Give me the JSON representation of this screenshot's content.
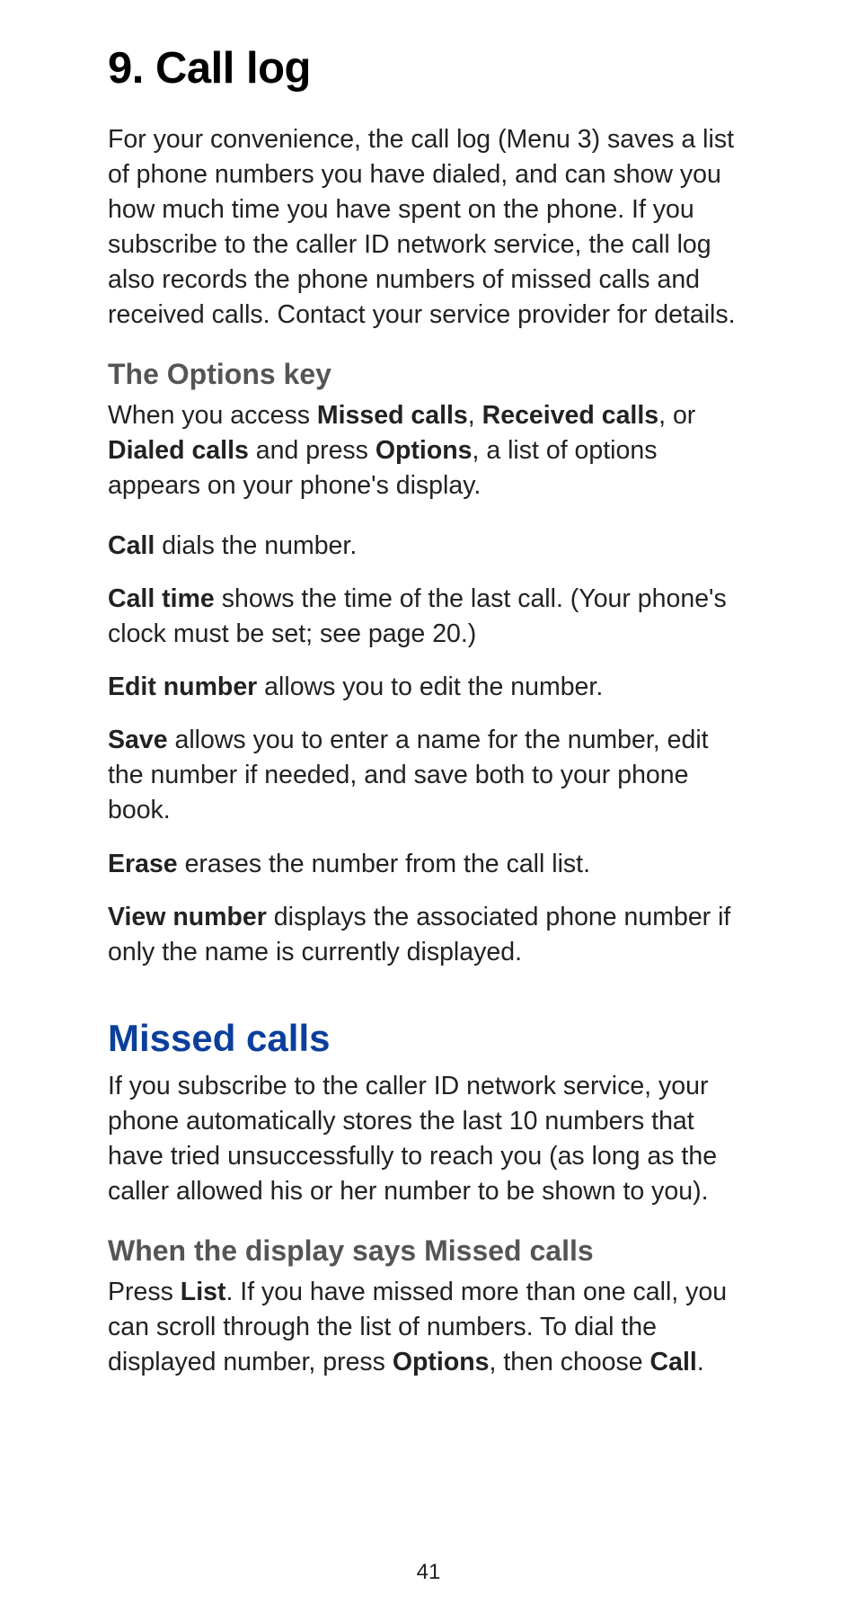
{
  "title": "9. Call log",
  "intro": "For your convenience, the call log (Menu 3) saves a list of phone numbers you have dialed, and can show you how much time you have spent on the phone. If you subscribe to the caller ID network service, the call log also records the phone numbers of missed calls and received calls. Contact your service provider for details.",
  "options_key": {
    "heading": "The Options key",
    "p1_prefix": "When you access ",
    "p1_b1": "Missed calls",
    "p1_sep1": ", ",
    "p1_b2": "Received calls",
    "p1_sep2": ", or ",
    "p1_b3": "Dialed calls",
    "p1_mid": " and press ",
    "p1_b4": "Options",
    "p1_suffix": ", a list of options appears on your phone's display.",
    "items": [
      {
        "b": "Call",
        "t": " dials the number."
      },
      {
        "b": "Call time",
        "t": " shows the time of the last call. (Your phone's clock must be set; see page 20.)"
      },
      {
        "b": "Edit number",
        "t": " allows you to edit the number."
      },
      {
        "b": "Save",
        "t": " allows you to enter a name for the number, edit the number if needed, and save both to your phone book."
      },
      {
        "b": "Erase",
        "t": " erases the number from the call list."
      },
      {
        "b": "View number",
        "t": " displays the associated phone number if only the name is currently displayed."
      }
    ]
  },
  "missed": {
    "heading": "Missed calls",
    "intro": "If you subscribe to the caller ID network service, your phone automatically stores the last 10 numbers that have tried unsuccessfully to reach you (as long as the caller allowed his or her number to be shown to you).",
    "sub": "When the display says Missed calls",
    "p_prefix": "Press ",
    "p_b1": "List",
    "p_mid1": ". If you have missed more than one call, you can scroll through the list of numbers. To dial the displayed number, press ",
    "p_b2": "Options",
    "p_mid2": ", then choose ",
    "p_b3": "Call",
    "p_suffix": "."
  },
  "page_number": "41"
}
